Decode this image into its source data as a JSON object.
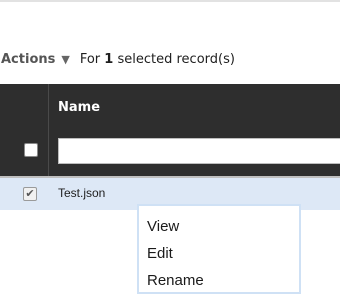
{
  "toolbar": {
    "actions_label": "Actions",
    "selection_prefix": "For ",
    "selected_count": "1",
    "selection_suffix": " selected record(s)"
  },
  "grid": {
    "columns": [
      "Name"
    ],
    "filter_value": "",
    "filter_placeholder": ""
  },
  "rows": [
    {
      "name": "Test.json",
      "checked": true
    }
  ],
  "context_menu": {
    "items": [
      "View",
      "Edit",
      "Rename"
    ]
  },
  "colors": {
    "header_bg": "#2e2e2e",
    "selected_row_bg": "#dde8f6",
    "menu_border": "#cfe1f5"
  }
}
